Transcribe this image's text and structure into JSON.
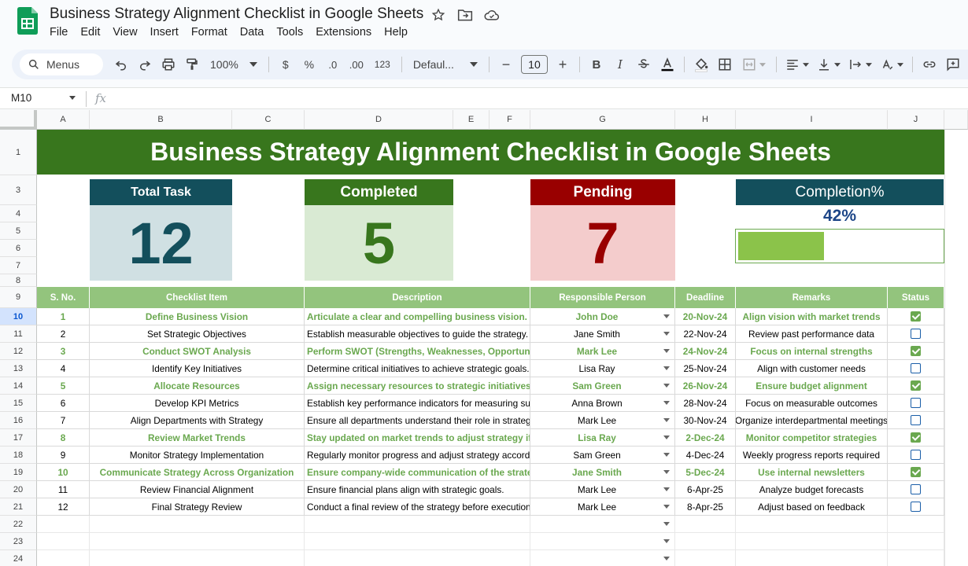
{
  "window": {
    "doc_title": "Business Strategy Alignment Checklist in Google Sheets",
    "menu": [
      "File",
      "Edit",
      "View",
      "Insert",
      "Format",
      "Data",
      "Tools",
      "Extensions",
      "Help"
    ]
  },
  "toolbar": {
    "menus_label": "Menus",
    "zoom": "100%",
    "currency": "$",
    "percent": "%",
    "decrease_decimal": ".0",
    "increase_decimal": ".00",
    "number_format": "123",
    "font": "Defaul...",
    "font_size": "10",
    "minus": "−",
    "plus": "+",
    "bold": "B",
    "italic_text": "I"
  },
  "formula_bar": {
    "name_box": "M10",
    "fx": "fx"
  },
  "columns": [
    "A",
    "B",
    "C",
    "D",
    "E",
    "F",
    "G",
    "H",
    "I",
    "J"
  ],
  "rows": [
    "1",
    "3",
    "4",
    "5",
    "6",
    "7",
    "8",
    "9",
    "10",
    "11",
    "12",
    "13",
    "14",
    "15",
    "16",
    "17",
    "18",
    "19",
    "20",
    "21",
    "22",
    "23",
    "24"
  ],
  "sheet": {
    "banner": "Business Strategy Alignment Checklist in Google Sheets",
    "kpis": {
      "total_label": "Total Task",
      "total_value": "12",
      "completed_label": "Completed",
      "completed_value": "5",
      "pending_label": "Pending",
      "pending_value": "7",
      "completion_label": "Completion%",
      "completion_value": "42%",
      "completion_fraction": 0.42
    },
    "headers": [
      "S. No.",
      "Checklist Item",
      "Description",
      "Responsible Person",
      "Deadline",
      "Remarks",
      "Status"
    ],
    "tasks": [
      {
        "no": "1",
        "item": "Define Business Vision",
        "desc": "Articulate a clear and compelling business vision.",
        "person": "John Doe",
        "deadline": "20-Nov-24",
        "remarks": "Align vision with market trends",
        "done": true
      },
      {
        "no": "2",
        "item": "Set Strategic Objectives",
        "desc": "Establish measurable objectives to guide the strategy.",
        "person": "Jane Smith",
        "deadline": "22-Nov-24",
        "remarks": "Review past performance data",
        "done": false
      },
      {
        "no": "3",
        "item": "Conduct SWOT Analysis",
        "desc": "Perform SWOT (Strengths, Weaknesses, Opportunities",
        "person": "Mark Lee",
        "deadline": "24-Nov-24",
        "remarks": "Focus on internal strengths",
        "done": true
      },
      {
        "no": "4",
        "item": "Identify Key Initiatives",
        "desc": "Determine critical initiatives to achieve strategic goals.",
        "person": "Lisa Ray",
        "deadline": "25-Nov-24",
        "remarks": "Align with customer needs",
        "done": false
      },
      {
        "no": "5",
        "item": "Allocate Resources",
        "desc": "Assign necessary resources to strategic initiatives.",
        "person": "Sam Green",
        "deadline": "26-Nov-24",
        "remarks": "Ensure budget alignment",
        "done": true
      },
      {
        "no": "6",
        "item": "Develop KPI Metrics",
        "desc": "Establish key performance indicators for measuring succes",
        "person": "Anna Brown",
        "deadline": "28-Nov-24",
        "remarks": "Focus on measurable outcomes",
        "done": false
      },
      {
        "no": "7",
        "item": "Align Departments with Strategy",
        "desc": "Ensure all departments understand their role in strategy.",
        "person": "Mark Lee",
        "deadline": "30-Nov-24",
        "remarks": "Organize interdepartmental meetings",
        "done": false
      },
      {
        "no": "8",
        "item": "Review Market Trends",
        "desc": "Stay updated on market trends to adjust strategy if nee",
        "person": "Lisa Ray",
        "deadline": "2-Dec-24",
        "remarks": "Monitor competitor strategies",
        "done": true
      },
      {
        "no": "9",
        "item": "Monitor Strategy Implementation",
        "desc": "Regularly monitor progress and adjust strategy accordingly",
        "person": "Sam Green",
        "deadline": "4-Dec-24",
        "remarks": "Weekly progress reports required",
        "done": false
      },
      {
        "no": "10",
        "item": "Communicate Strategy Across Organization",
        "desc": "Ensure company-wide communication of the strategy.",
        "person": "Jane Smith",
        "deadline": "5-Dec-24",
        "remarks": "Use internal newsletters",
        "done": true
      },
      {
        "no": "11",
        "item": "Review Financial Alignment",
        "desc": "Ensure financial plans align with strategic goals.",
        "person": "Mark Lee",
        "deadline": "6-Apr-25",
        "remarks": "Analyze budget forecasts",
        "done": false
      },
      {
        "no": "12",
        "item": "Final Strategy Review",
        "desc": "Conduct a final review of the strategy before execution.",
        "person": "Mark Lee",
        "deadline": "8-Apr-25",
        "remarks": "Adjust based on feedback",
        "done": false
      }
    ]
  },
  "colors": {
    "banner": "#38761d",
    "total_head": "#134f5c",
    "total_body": "#d0e0e3",
    "total_text": "#134f5c",
    "completed_head": "#38761d",
    "completed_body": "#d9ead3",
    "completed_text": "#38761d",
    "pending_head": "#990000",
    "pending_body": "#f4cccc",
    "pending_text": "#990000",
    "completion_head": "#134f5c",
    "header_bg": "#93c47d",
    "done_text": "#6aa84f"
  }
}
